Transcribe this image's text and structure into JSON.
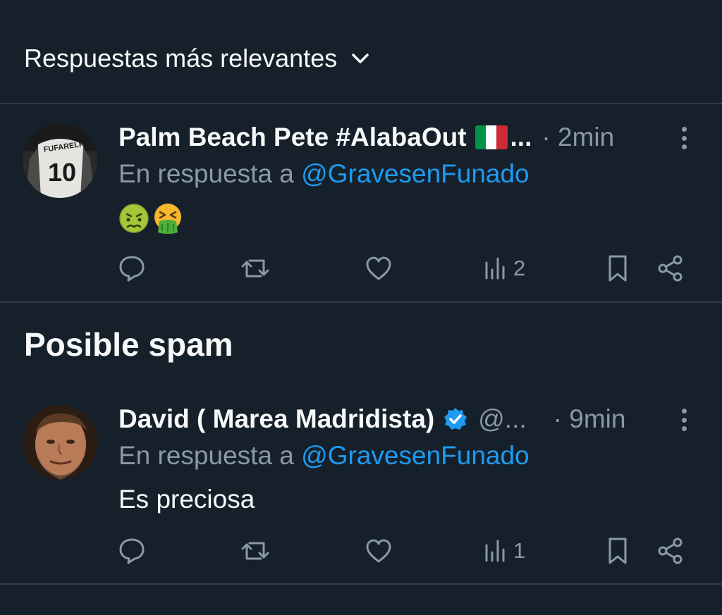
{
  "sort": {
    "label": "Respuestas más relevantes",
    "icon": "chevron-down-icon"
  },
  "section": {
    "title": "Posible spam"
  },
  "posts": [
    {
      "display_name": "Palm Beach Pete #AlabaOut",
      "flag": "Italy",
      "ellipsis": "...",
      "handle": "",
      "time": "· 2min",
      "reply_prefix": "En respuesta a",
      "reply_to": "@GravesenFunado",
      "emojis": [
        "nauseated-face",
        "face-vomiting"
      ],
      "text": "",
      "avatar_jersey_text": "FUFARELK",
      "avatar_jersey_number": "10",
      "views": "2"
    },
    {
      "display_name": "David ( Marea Madridista)",
      "verified": true,
      "handle": "@...",
      "time": "· 9min",
      "reply_prefix": "En respuesta a",
      "reply_to": "@GravesenFunado",
      "text": "Es preciosa",
      "views": "1"
    }
  ],
  "colors": {
    "background": "#15202b",
    "text": "#f7f9f9",
    "muted": "#8b98a5",
    "accent": "#1d9bf0",
    "divider": "#2f3b45"
  }
}
